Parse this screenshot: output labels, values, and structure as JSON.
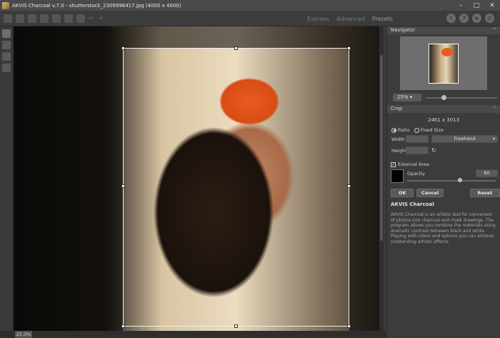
{
  "window": {
    "title": "AKVIS Charcoal v.7.0 - shutterstock_2309996417.jpg (4000 x 4000)",
    "minimize": "–",
    "maximize": "□",
    "close": "✕"
  },
  "toolbar": {
    "undo": "←",
    "redo": "→",
    "modes": [
      "Express",
      "Advanced",
      "Presets"
    ],
    "right_icons": [
      "i",
      "?",
      "★",
      "⚙"
    ]
  },
  "status": {
    "zoom": "25.0%"
  },
  "navigator": {
    "title": "Navigator",
    "collapse": "⌃",
    "zoom_value": "25% ▾",
    "zoom_level": 0.3
  },
  "crop": {
    "title": "Crop",
    "collapse": "⌃",
    "size": "2461 x 3013",
    "ratio_label": "Ratio",
    "fixed_size_label": "Fixed Size",
    "width_label": "Width",
    "height_label": "Height",
    "mode_select": "Freehand",
    "select_caret": "▾",
    "refresh": "↻",
    "external_area_label": "External Area",
    "external_area_check": "✓",
    "opacity_label": "Opacity",
    "opacity_value": "60",
    "ok_label": "OK",
    "cancel_label": "Cancel",
    "reset_label": "Reset"
  },
  "info": {
    "title": "AKVIS Charcoal",
    "text": "AKVIS Charcoal is an artistic tool for conversion of photos into charcoal and chalk drawings. The program allows you combine the materials using dramatic contrast between black and white. Playing with colors and options you can achieve outstanding artistic effects."
  },
  "colors": {
    "background": "#3a3a3a",
    "panel": "#3c3c3c",
    "accent": "#e85a1f"
  }
}
